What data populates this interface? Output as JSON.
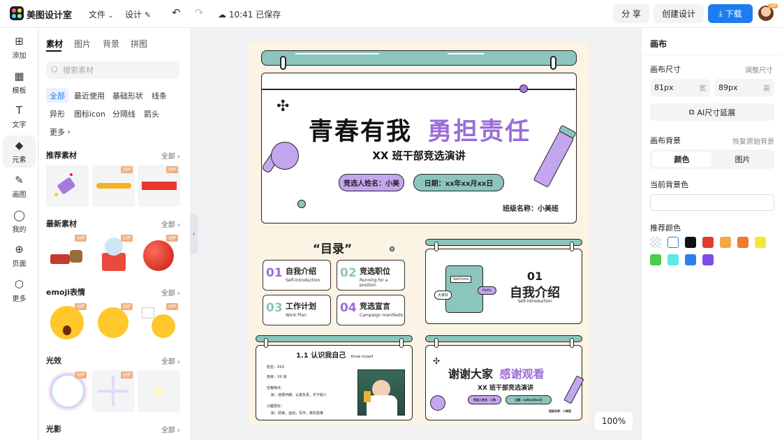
{
  "app": {
    "name": "美图设计室"
  },
  "menu": {
    "file": "文件",
    "design": "设计",
    "save_status": "10:41 已保存"
  },
  "toolbar": {
    "share": "分 享",
    "create": "创建设计",
    "download": "下载",
    "vip_badge": "VIP"
  },
  "leftnav": [
    {
      "label": "添加",
      "icon": "plus-square-icon"
    },
    {
      "label": "模板",
      "icon": "template-icon"
    },
    {
      "label": "文字",
      "icon": "text-icon"
    },
    {
      "label": "元素",
      "icon": "shapes-icon"
    },
    {
      "label": "画图",
      "icon": "draw-icon"
    },
    {
      "label": "我的",
      "icon": "user-icon"
    },
    {
      "label": "页面",
      "icon": "page-add-icon"
    },
    {
      "label": "更多",
      "icon": "cube-icon"
    }
  ],
  "panel": {
    "tabs": [
      "素材",
      "图片",
      "背景",
      "拼图"
    ],
    "search_placeholder": "搜索素材",
    "chips": [
      "全部",
      "最近使用",
      "基础形状",
      "线条",
      "异形",
      "图标icon",
      "分隔线",
      "箭头",
      "更多"
    ],
    "sections": [
      {
        "title": "推荐素材",
        "all": "全部"
      },
      {
        "title": "最新素材",
        "all": "全部"
      },
      {
        "title": "emoji表情",
        "all": "全部"
      },
      {
        "title": "光效",
        "all": "全部"
      },
      {
        "title": "光影",
        "all": "全部"
      }
    ],
    "vip": "VIP"
  },
  "slides": {
    "cover": {
      "title_black": "青春有我",
      "title_purple": "勇担责任",
      "subtitle": "XX 班干部竞选演讲",
      "candidate": "竞选人姓名：小美",
      "date": "日期：xx年xx月xx日",
      "class_name": "班级名称：小美班"
    },
    "toc": {
      "title": "“目录”",
      "items": [
        {
          "num": "01",
          "title": "自我介绍",
          "sub": "Self-introduction"
        },
        {
          "num": "02",
          "title": "竞选职位",
          "sub": "Running for a position"
        },
        {
          "num": "03",
          "title": "工作计划",
          "sub": "Work Plan"
        },
        {
          "num": "04",
          "title": "竞选宣言",
          "sub": "Campaign manifesto"
        }
      ]
    },
    "intro": {
      "num": "01",
      "title": "自我介绍",
      "sub": "Self-introduction",
      "book_label": "Self-intro",
      "bubble_a": "大家好",
      "bubble_b": "Hello"
    },
    "know": {
      "title": "1.1 认识我自己",
      "sub": "Know myself",
      "lines": [
        "姓名：XXX",
        "班级：XX 班",
        "性格特点：",
        "如：他很开朗，认真负责，乐于助人",
        "兴趣爱好：",
        "如：阅读，运动，写作，做实验等"
      ]
    },
    "thanks": {
      "black": "谢谢大家",
      "purple": "感谢观看",
      "subtitle": "XX 班干部竞选演讲",
      "candidate": "竞选人姓名：小美",
      "date": "日期：xx年xx月xx日",
      "class_name": "班级名称：小美班"
    }
  },
  "zoom": "100%",
  "rightpanel": {
    "title": "画布",
    "size_label": "画布尺寸",
    "resize_link": "调整尺寸",
    "width_value": "81px",
    "width_unit": "宽",
    "height_value": "89px",
    "height_unit": "高",
    "ai_button": "AI尺寸延展",
    "bg_label": "画布背景",
    "restore_link": "恢复原始背景",
    "seg_color": "颜色",
    "seg_image": "图片",
    "current_bg_label": "当前背景色",
    "recommended_label": "推荐颜色",
    "colors": [
      "transparent",
      "#ffffff",
      "#111111",
      "#e8392c",
      "#f2a84b",
      "#f07a2a",
      "#f5e63a",
      "#4fca4a",
      "#5ce8e6",
      "#2f7ef0",
      "#7a4de8"
    ]
  }
}
